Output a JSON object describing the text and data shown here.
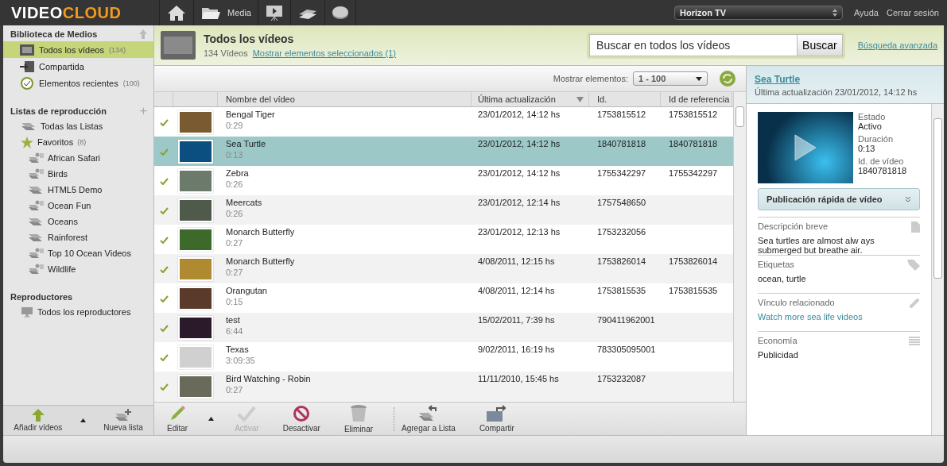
{
  "topbar": {
    "logo_a": "VIDEO",
    "logo_b": "CLOUD",
    "nav": [
      {
        "kind": "home"
      },
      {
        "kind": "media",
        "label": "Media"
      },
      {
        "kind": "player"
      },
      {
        "kind": "money"
      },
      {
        "kind": "chart"
      }
    ],
    "account": "Horizon TV",
    "links": [
      "Ayuda",
      "Cerrar sesión"
    ]
  },
  "sidebar": {
    "library_title": "Biblioteca de Medios",
    "library": [
      {
        "kind": "all",
        "label": "Todos los vídeos",
        "count": "(134)",
        "selected": true
      },
      {
        "kind": "shared",
        "label": "Compartida",
        "selected": false
      },
      {
        "kind": "recent",
        "label": "Elementos recientes",
        "count": "(100)",
        "selected": false
      }
    ],
    "playlists_title": "Listas de reproducción",
    "add_symbol": "+",
    "playlists": [
      {
        "kind": "all",
        "label": "Todas las Listas"
      },
      {
        "kind": "favorites",
        "label": "Favoritos",
        "count": "(8)",
        "children": [
          {
            "kind": "smart",
            "label": "African Safari"
          },
          {
            "kind": "smart",
            "label": "Birds"
          },
          {
            "kind": "manual",
            "label": "HTML5 Demo"
          },
          {
            "kind": "smart",
            "label": "Ocean Fun"
          },
          {
            "kind": "manual",
            "label": "Oceans"
          },
          {
            "kind": "manual",
            "label": "Rainforest"
          },
          {
            "kind": "smart",
            "label": "Top 10 Ocean Videos"
          },
          {
            "kind": "smart",
            "label": "Wildlife"
          }
        ]
      }
    ],
    "players_title": "Reproductores",
    "players": [
      "Todos los reproductores"
    ],
    "buttons": [
      {
        "kind": "upload",
        "label": "Añadir vídeos"
      },
      {
        "kind": "newlist",
        "label": "Nueva lista"
      }
    ]
  },
  "header": {
    "title": "Todos los vídeos",
    "count": "134 Vídeos",
    "selected_link": "Mostrar elementos seleccionados (1)",
    "search": {
      "placeholder": "Buscar en todos los vídeos"
    },
    "search_button": "Buscar",
    "advanced": "Búsqueda avanzada"
  },
  "list": {
    "show_label": "Mostrar elementos:",
    "page": "1 - 100",
    "columns": [
      "Nombre del vídeo",
      "Última actualización",
      "Id.",
      "Id de referencia"
    ],
    "rows": [
      {
        "name": "Bengal Tiger",
        "duration": "0:29",
        "updated": "23/01/2012, 14:12 hs",
        "id": "1753815512",
        "ref": "1753815512",
        "active": true,
        "selected": false
      },
      {
        "name": "Sea Turtle",
        "duration": "0:13",
        "updated": "23/01/2012, 14:12 hs",
        "id": "1840781818",
        "ref": "1840781818",
        "active": true,
        "selected": true
      },
      {
        "name": "Zebra",
        "duration": "0:26",
        "updated": "23/01/2012, 14:12 hs",
        "id": "1755342297",
        "ref": "1755342297",
        "active": true,
        "selected": false
      },
      {
        "name": "Meercats",
        "duration": "0:26",
        "updated": "23/01/2012, 12:14 hs",
        "id": "1757548650",
        "ref": "",
        "active": true,
        "selected": false
      },
      {
        "name": "Monarch Butterfly",
        "duration": "0:27",
        "updated": "23/01/2012, 12:13 hs",
        "id": "1753232056",
        "ref": "",
        "active": true,
        "selected": false
      },
      {
        "name": "Monarch Butterfly",
        "duration": "0:27",
        "updated": "4/08/2011, 12:15 hs",
        "id": "1753826014",
        "ref": "1753826014",
        "active": true,
        "selected": false
      },
      {
        "name": "Orangutan",
        "duration": "0:15",
        "updated": "4/08/2011, 12:14 hs",
        "id": "1753815535",
        "ref": "1753815535",
        "active": true,
        "selected": false
      },
      {
        "name": "test",
        "duration": "6:44",
        "updated": "15/02/2011, 7:39 hs",
        "id": "790411962001",
        "ref": "",
        "active": true,
        "selected": false
      },
      {
        "name": "Texas",
        "duration": "3:09:35",
        "updated": "9/02/2011, 16:19 hs",
        "id": "783305095001",
        "ref": "",
        "active": true,
        "selected": false
      },
      {
        "name": "Bird Watching - Robin",
        "duration": "0:27",
        "updated": "11/11/2010, 15:45 hs",
        "id": "1753232087",
        "ref": "",
        "active": true,
        "selected": false
      }
    ]
  },
  "actions": [
    {
      "kind": "edit",
      "label": "Editar",
      "disabled": false
    },
    {
      "kind": "activate",
      "label": "Activar",
      "disabled": true
    },
    {
      "kind": "deactivate",
      "label": "Desactivar",
      "disabled": false
    },
    {
      "kind": "delete",
      "label": "Eliminar",
      "disabled": false
    },
    {
      "kind": "addlist",
      "label": "Agregar a Lista",
      "disabled": false
    },
    {
      "kind": "share",
      "label": "Compartir",
      "disabled": false
    }
  ],
  "detail": {
    "title": "Sea Turtle",
    "updated": "Última actualización 23/01/2012, 14:12 hs",
    "meta": [
      {
        "label": "Estado",
        "value": "Activo"
      },
      {
        "label": "Duración",
        "value": "0:13"
      },
      {
        "label": "Id. de vídeo",
        "value": "1840781818"
      }
    ],
    "publish": "Publicación rápida de vídeo",
    "sections": [
      {
        "kind": "doc",
        "label": "Descripción breve",
        "value": "Sea turtles are almost alw ays submerged but breathe air.",
        "link": false
      },
      {
        "kind": "tag",
        "label": "Etiquetas",
        "value": "ocean, turtle",
        "link": false
      },
      {
        "kind": "link",
        "label": "Vínculo relacionado",
        "value": "Watch more sea life videos",
        "link": true
      },
      {
        "kind": "list",
        "label": "Economía",
        "value": "Publicidad",
        "link": false
      }
    ]
  }
}
